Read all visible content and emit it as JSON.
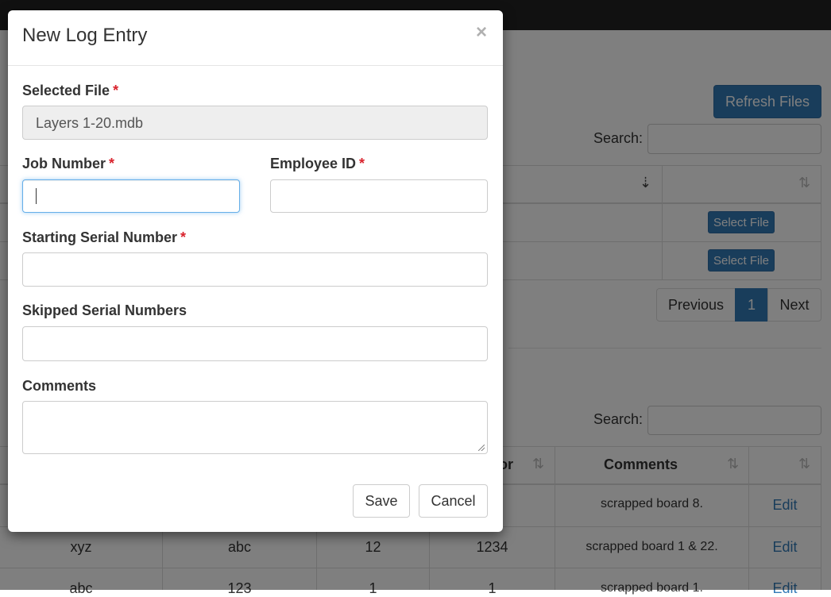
{
  "background": {
    "refresh_button": "Refresh Files",
    "files_search_label": "Search:",
    "select_file_button": "Select File",
    "pagination": {
      "previous": "Previous",
      "current": "1",
      "next": "Next"
    },
    "logs_search_label": "Search:",
    "logs_headers": {
      "operator_partial": "or",
      "comments": "Comments"
    },
    "logs_rows": [
      {
        "col1": "",
        "col2": "",
        "col3": "",
        "col4": "",
        "comments": "scrapped board 8.",
        "action": "Edit"
      },
      {
        "col1": "xyz",
        "col2": "abc",
        "col3": "12",
        "col4": "1234",
        "comments": "scrapped board 1 & 22.",
        "action": "Edit"
      },
      {
        "col1": "abc",
        "col2": "123",
        "col3": "1",
        "col4": "1",
        "comments": "scrapped board 1.",
        "action": "Edit"
      }
    ]
  },
  "modal": {
    "title": "New Log Entry",
    "close_symbol": "×",
    "required_marker": "*",
    "fields": {
      "selected_file": {
        "label": "Selected File",
        "value": "Layers 1-20.mdb"
      },
      "job_number": {
        "label": "Job Number",
        "value": ""
      },
      "employee_id": {
        "label": "Employee ID",
        "value": ""
      },
      "starting_serial": {
        "label": "Starting Serial Number",
        "value": ""
      },
      "skipped_serials": {
        "label": "Skipped Serial Numbers",
        "value": ""
      },
      "comments": {
        "label": "Comments",
        "value": ""
      }
    },
    "buttons": {
      "save": "Save",
      "cancel": "Cancel"
    }
  }
}
